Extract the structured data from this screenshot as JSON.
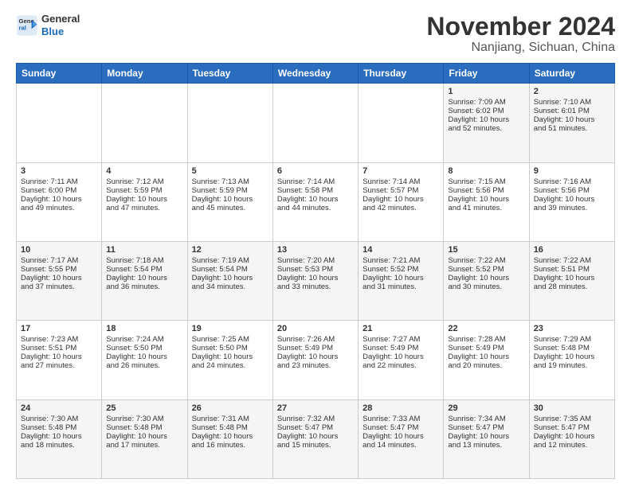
{
  "logo": {
    "line1": "General",
    "line2": "Blue"
  },
  "title": "November 2024",
  "subtitle": "Nanjiang, Sichuan, China",
  "weekdays": [
    "Sunday",
    "Monday",
    "Tuesday",
    "Wednesday",
    "Thursday",
    "Friday",
    "Saturday"
  ],
  "weeks": [
    [
      {
        "day": "",
        "info": ""
      },
      {
        "day": "",
        "info": ""
      },
      {
        "day": "",
        "info": ""
      },
      {
        "day": "",
        "info": ""
      },
      {
        "day": "",
        "info": ""
      },
      {
        "day": "1",
        "info": "Sunrise: 7:09 AM\nSunset: 6:02 PM\nDaylight: 10 hours\nand 52 minutes."
      },
      {
        "day": "2",
        "info": "Sunrise: 7:10 AM\nSunset: 6:01 PM\nDaylight: 10 hours\nand 51 minutes."
      }
    ],
    [
      {
        "day": "3",
        "info": "Sunrise: 7:11 AM\nSunset: 6:00 PM\nDaylight: 10 hours\nand 49 minutes."
      },
      {
        "day": "4",
        "info": "Sunrise: 7:12 AM\nSunset: 5:59 PM\nDaylight: 10 hours\nand 47 minutes."
      },
      {
        "day": "5",
        "info": "Sunrise: 7:13 AM\nSunset: 5:59 PM\nDaylight: 10 hours\nand 45 minutes."
      },
      {
        "day": "6",
        "info": "Sunrise: 7:14 AM\nSunset: 5:58 PM\nDaylight: 10 hours\nand 44 minutes."
      },
      {
        "day": "7",
        "info": "Sunrise: 7:14 AM\nSunset: 5:57 PM\nDaylight: 10 hours\nand 42 minutes."
      },
      {
        "day": "8",
        "info": "Sunrise: 7:15 AM\nSunset: 5:56 PM\nDaylight: 10 hours\nand 41 minutes."
      },
      {
        "day": "9",
        "info": "Sunrise: 7:16 AM\nSunset: 5:56 PM\nDaylight: 10 hours\nand 39 minutes."
      }
    ],
    [
      {
        "day": "10",
        "info": "Sunrise: 7:17 AM\nSunset: 5:55 PM\nDaylight: 10 hours\nand 37 minutes."
      },
      {
        "day": "11",
        "info": "Sunrise: 7:18 AM\nSunset: 5:54 PM\nDaylight: 10 hours\nand 36 minutes."
      },
      {
        "day": "12",
        "info": "Sunrise: 7:19 AM\nSunset: 5:54 PM\nDaylight: 10 hours\nand 34 minutes."
      },
      {
        "day": "13",
        "info": "Sunrise: 7:20 AM\nSunset: 5:53 PM\nDaylight: 10 hours\nand 33 minutes."
      },
      {
        "day": "14",
        "info": "Sunrise: 7:21 AM\nSunset: 5:52 PM\nDaylight: 10 hours\nand 31 minutes."
      },
      {
        "day": "15",
        "info": "Sunrise: 7:22 AM\nSunset: 5:52 PM\nDaylight: 10 hours\nand 30 minutes."
      },
      {
        "day": "16",
        "info": "Sunrise: 7:22 AM\nSunset: 5:51 PM\nDaylight: 10 hours\nand 28 minutes."
      }
    ],
    [
      {
        "day": "17",
        "info": "Sunrise: 7:23 AM\nSunset: 5:51 PM\nDaylight: 10 hours\nand 27 minutes."
      },
      {
        "day": "18",
        "info": "Sunrise: 7:24 AM\nSunset: 5:50 PM\nDaylight: 10 hours\nand 26 minutes."
      },
      {
        "day": "19",
        "info": "Sunrise: 7:25 AM\nSunset: 5:50 PM\nDaylight: 10 hours\nand 24 minutes."
      },
      {
        "day": "20",
        "info": "Sunrise: 7:26 AM\nSunset: 5:49 PM\nDaylight: 10 hours\nand 23 minutes."
      },
      {
        "day": "21",
        "info": "Sunrise: 7:27 AM\nSunset: 5:49 PM\nDaylight: 10 hours\nand 22 minutes."
      },
      {
        "day": "22",
        "info": "Sunrise: 7:28 AM\nSunset: 5:49 PM\nDaylight: 10 hours\nand 20 minutes."
      },
      {
        "day": "23",
        "info": "Sunrise: 7:29 AM\nSunset: 5:48 PM\nDaylight: 10 hours\nand 19 minutes."
      }
    ],
    [
      {
        "day": "24",
        "info": "Sunrise: 7:30 AM\nSunset: 5:48 PM\nDaylight: 10 hours\nand 18 minutes."
      },
      {
        "day": "25",
        "info": "Sunrise: 7:30 AM\nSunset: 5:48 PM\nDaylight: 10 hours\nand 17 minutes."
      },
      {
        "day": "26",
        "info": "Sunrise: 7:31 AM\nSunset: 5:48 PM\nDaylight: 10 hours\nand 16 minutes."
      },
      {
        "day": "27",
        "info": "Sunrise: 7:32 AM\nSunset: 5:47 PM\nDaylight: 10 hours\nand 15 minutes."
      },
      {
        "day": "28",
        "info": "Sunrise: 7:33 AM\nSunset: 5:47 PM\nDaylight: 10 hours\nand 14 minutes."
      },
      {
        "day": "29",
        "info": "Sunrise: 7:34 AM\nSunset: 5:47 PM\nDaylight: 10 hours\nand 13 minutes."
      },
      {
        "day": "30",
        "info": "Sunrise: 7:35 AM\nSunset: 5:47 PM\nDaylight: 10 hours\nand 12 minutes."
      }
    ]
  ]
}
